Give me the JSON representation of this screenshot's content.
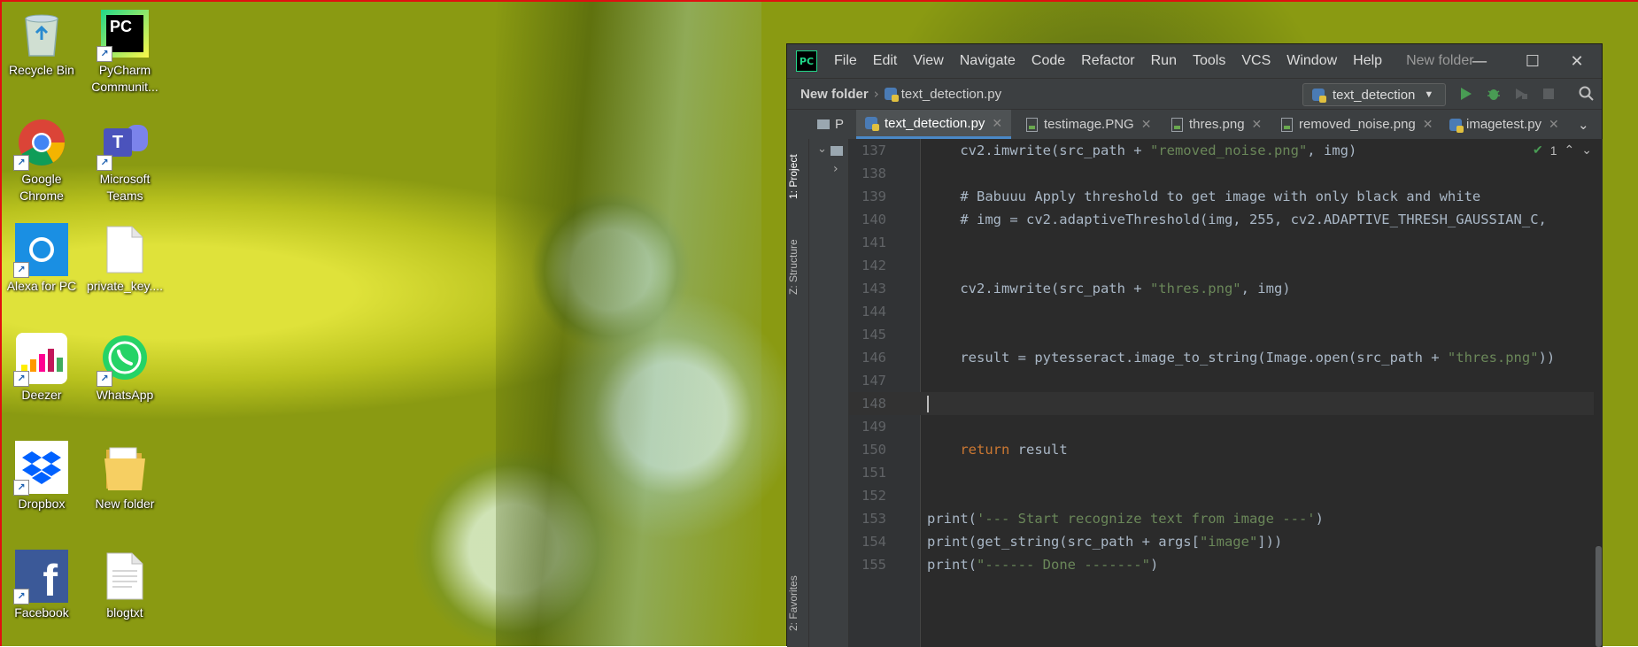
{
  "desktop": {
    "icons": [
      {
        "label": "Recycle Bin"
      },
      {
        "label": "PyCharm Communit..."
      },
      {
        "label": "Google Chrome"
      },
      {
        "label": "Microsoft Teams"
      },
      {
        "label": "Alexa for PC"
      },
      {
        "label": "private_key...."
      },
      {
        "label": "Deezer"
      },
      {
        "label": "WhatsApp"
      },
      {
        "label": "Dropbox"
      },
      {
        "label": "New folder"
      },
      {
        "label": "Facebook"
      },
      {
        "label": "blogtxt"
      }
    ]
  },
  "ide": {
    "logo": "PC",
    "menu": [
      "File",
      "Edit",
      "View",
      "Navigate",
      "Code",
      "Refactor",
      "Run",
      "Tools",
      "VCS",
      "Window",
      "Help"
    ],
    "window_title": "New folder",
    "breadcrumb": {
      "folder": "New folder",
      "file": "text_detection.py"
    },
    "run_config": "text_detection",
    "tabs": [
      {
        "label": "text_detection.py",
        "active": true
      },
      {
        "label": "testimage.PNG"
      },
      {
        "label": "thres.png"
      },
      {
        "label": "removed_noise.png"
      },
      {
        "label": "imagetest.py"
      }
    ],
    "project_tab_short": "P",
    "side_tabs": {
      "project": "1: Project",
      "structure": "Z: Structure",
      "favorites": "2: Favorites"
    },
    "inspection_count": "1",
    "code_lines": [
      {
        "n": "137"
      },
      {
        "n": "138"
      },
      {
        "n": "139"
      },
      {
        "n": "140"
      },
      {
        "n": "141"
      },
      {
        "n": "142"
      },
      {
        "n": "143"
      },
      {
        "n": "144"
      },
      {
        "n": "145"
      },
      {
        "n": "146"
      },
      {
        "n": "147"
      },
      {
        "n": "148"
      },
      {
        "n": "149"
      },
      {
        "n": "150"
      },
      {
        "n": "151"
      },
      {
        "n": "152"
      },
      {
        "n": "153"
      },
      {
        "n": "154"
      },
      {
        "n": "155"
      }
    ],
    "code": {
      "l137a": "    cv2.imwrite(src_path + ",
      "l137s": "\"removed_noise.png\"",
      "l137b": ", img)",
      "l139": "    # Babuuu Apply threshold to get image with only black and white",
      "l140": "    # img = cv2.adaptiveThreshold(img, 255, cv2.ADAPTIVE_THRESH_GAUSSIAN_C,",
      "l143a": "    cv2.imwrite(src_path + ",
      "l143s": "\"thres.png\"",
      "l143b": ", img)",
      "l146a": "    result = pytesseract.image_to_string(Image.open(src_path + ",
      "l146s": "\"thres.png\"",
      "l146b": "))",
      "l150k": "    return",
      "l150b": " result",
      "l153a": "print(",
      "l153s": "'--- Start recognize text from image ---'",
      "l153b": ")",
      "l154a": "print(get_string(src_path + args[",
      "l154s": "\"image\"",
      "l154b": "]))",
      "l155a": "print(",
      "l155s": "\"------ Done -------\"",
      "l155b": ")"
    }
  }
}
